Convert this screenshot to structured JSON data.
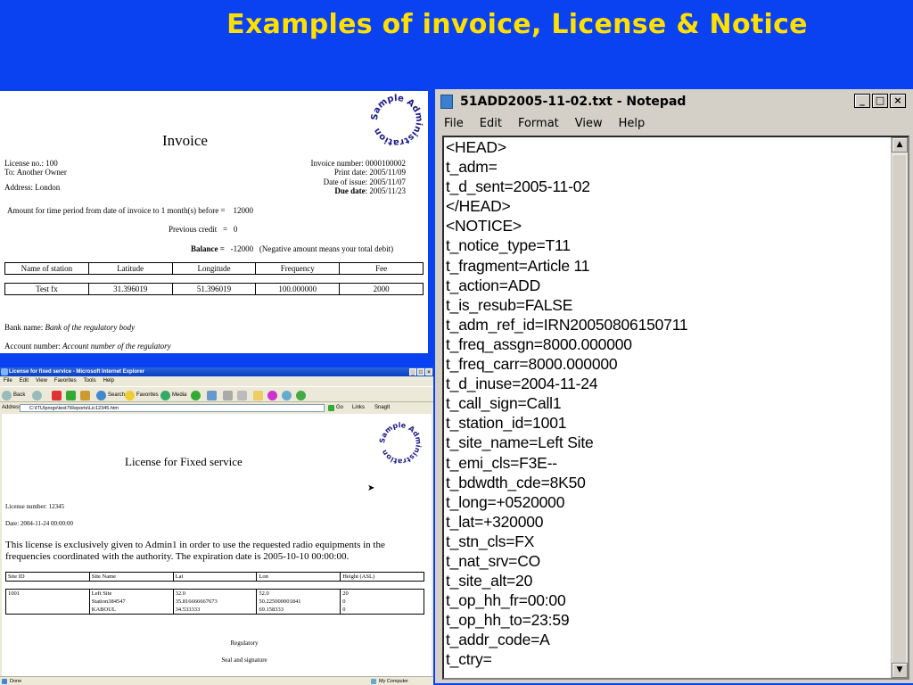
{
  "slide": {
    "title": "Examples of invoice, License & Notice"
  },
  "seal_text": "Sample Administration",
  "invoice": {
    "title": "Invoice",
    "license_no": "License no.: 100",
    "to": "To: Another Owner",
    "address": "Address: London",
    "invoice_number": "Invoice number: 0000100002",
    "print_date": "Print date: 2005/11/09",
    "date_of_issue": "Date of issue: 2005/11/07",
    "due_date_label": "Due date",
    "due_date_value": ": 2005/11/23",
    "amount_text": "Amount for time period from date of invoice to 1 month(s) before =",
    "amount_value": "12000",
    "previous_credit_label": "Previous credit",
    "previous_credit_eq": "=",
    "previous_credit_value": "0",
    "balance_label": "Balance =",
    "balance_value": "-12000",
    "balance_note": "(Negative amount means your total debit)",
    "table_headers": [
      "Name of station",
      "Latitude",
      "Longitude",
      "Frequency",
      "Fee"
    ],
    "table_rows": [
      [
        "Test fx",
        "31.396019",
        "51.396019",
        "100.000000",
        "2000"
      ]
    ],
    "bank_name_label": "Bank name:",
    "bank_name_value": "Bank of the regulatory body",
    "account_label": "Account number:",
    "account_value": "Account number of the regulatory"
  },
  "ie": {
    "window_title": "License for fixed service - Microsoft Internet Explorer",
    "menu": [
      "File",
      "Edit",
      "View",
      "Favorites",
      "Tools",
      "Help"
    ],
    "toolbar": {
      "back": "Back",
      "search": "Search",
      "favorites": "Favorites",
      "media": "Media"
    },
    "address_label": "Address",
    "address_value": "C:\\ITU\\progs\\test7\\Reports\\Lic12345.htm",
    "go": "Go",
    "links": "Links",
    "snagit": "SnagIt",
    "status_left": "Done",
    "status_right": "My Computer",
    "license": {
      "title": "License for Fixed service",
      "license_number": "License number: 12345",
      "date": "Date: 2004-11-24 00:00:00",
      "paragraph": "This license is exclusively given to Admin1 in order to use the requested radio equipments in the frequencies coordinated with the authority. The expiration date is 2005-10-10 00:00:00.",
      "table_headers": [
        "Site ID",
        "Site Name",
        "Lat",
        "Lon",
        "Height (ASL)"
      ],
      "table_rows": [
        [
          "1001",
          "Left Site",
          "32.0",
          "52.0",
          "20"
        ],
        [
          "",
          "Station384547",
          "35.816666667673",
          "50.225000001841",
          "0"
        ],
        [
          "",
          "KABOUL",
          "34.533333",
          "69.158333",
          "0"
        ]
      ],
      "regulatory": "Regulatory",
      "seal_signature": "Seal and signature"
    }
  },
  "notepad": {
    "title": "51ADD2005-11-02.txt - Notepad",
    "menu": [
      "File",
      "Edit",
      "Format",
      "View",
      "Help"
    ],
    "lines": [
      "<HEAD>",
      "t_adm=",
      "t_d_sent=2005-11-02",
      "</HEAD>",
      "<NOTICE>",
      "t_notice_type=T11",
      "t_fragment=Article 11",
      "t_action=ADD",
      "t_is_resub=FALSE",
      "t_adm_ref_id=IRN20050806150711",
      "t_freq_assgn=8000.000000",
      "t_freq_carr=8000.000000",
      "t_d_inuse=2004-11-24",
      "t_call_sign=Call1",
      "t_station_id=1001",
      "t_site_name=Left Site",
      "t_emi_cls=F3E--",
      "t_bdwdth_cde=8K50",
      "t_long=+0520000",
      "t_lat=+320000",
      "t_stn_cls=FX",
      "t_nat_srv=CO",
      "t_site_alt=20",
      "t_op_hh_fr=00:00",
      "t_op_hh_to=23:59",
      "t_addr_code=A",
      "t_ctry="
    ]
  }
}
